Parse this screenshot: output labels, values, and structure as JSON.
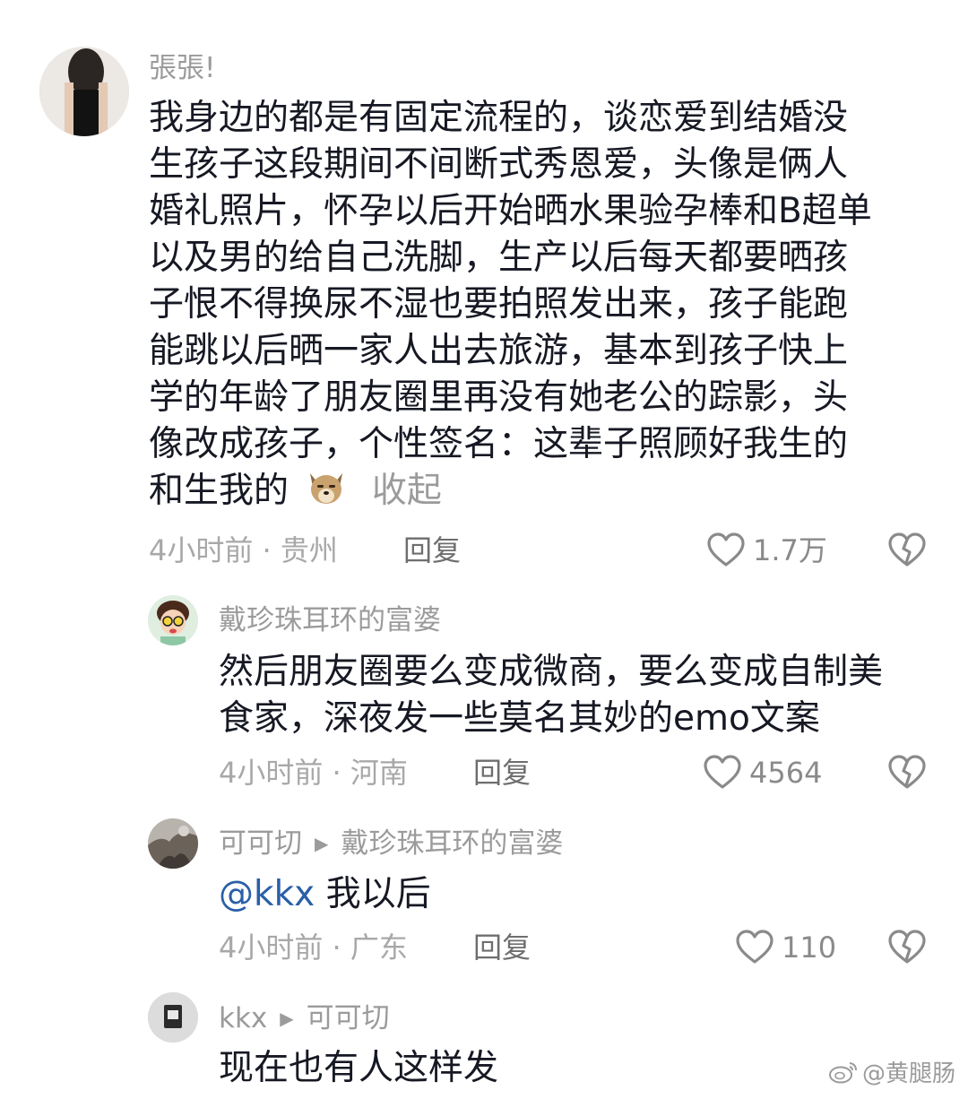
{
  "comments": [
    {
      "username": "張張!",
      "lines": [
        "我身边的都是有固定流程的，谈恋爱到结婚没",
        "生孩子这段期间不间断式秀恩爱，头像是俩人",
        "婚礼照片，怀孕以后开始晒水果验孕棒和B超单",
        "以及男的给自己洗脚，生产以后每天都要晒孩",
        "子恨不得换尿不湿也要拍照发出来，孩子能跑",
        "能跳以后晒一家人出去旅游，基本到孩子快上",
        "学的年龄了朋友圈里再没有她老公的踪影，头",
        "像改成孩子，个性签名：这辈子照顾好我生的"
      ],
      "last_line": "和生我的",
      "emoji": "dog-face-emoji",
      "collapse_label": "收起",
      "time_location": "4小时前 · 贵州",
      "reply_label": "回复",
      "likes": "1.7万"
    },
    {
      "username": "戴珍珠耳环的富婆",
      "lines": [
        "然后朋友圈要么变成微商，要么变成自制美",
        "食家，深夜发一些莫名其妙的emo文案"
      ],
      "time_location": "4小时前 · 河南",
      "reply_label": "回复",
      "likes": "4564"
    },
    {
      "username": "可可切",
      "reply_to": "戴珍珠耳环的富婆",
      "mention": "@kkx",
      "text": " 我以后",
      "time_location": "4小时前 · 广东",
      "reply_label": "回复",
      "likes": "110"
    },
    {
      "username": "kkx",
      "reply_to": "可可切",
      "text": "现在也有人这样发"
    }
  ],
  "watermark": "@黄腿肠",
  "colors": {
    "text": "#161823",
    "username": "#9b9b9b",
    "mention": "#2a5fa8",
    "meta": "#a8a8a8"
  }
}
